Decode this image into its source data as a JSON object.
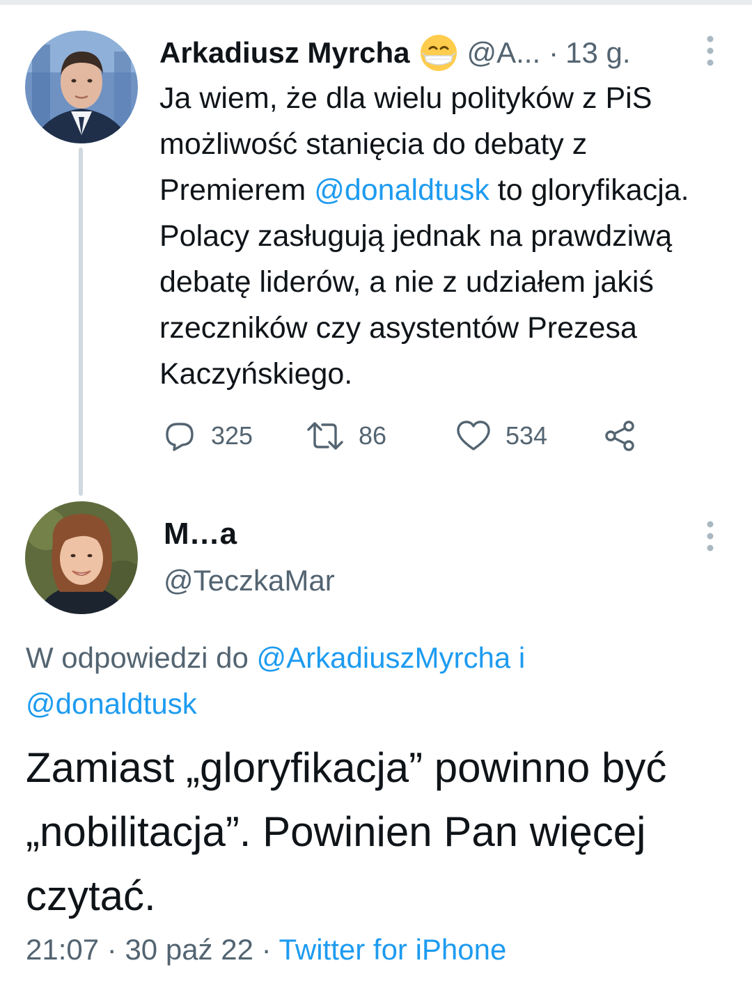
{
  "parent_tweet": {
    "author_name": "Arkadiusz Myrcha",
    "author_emoji": "😷",
    "handle": "@A...",
    "separator": "·",
    "time_ago": "13 g.",
    "text_parts": {
      "before_mention": "Ja wiem, że dla wielu polityków z PiS możliwość stanięcia do debaty z Premierem ",
      "mention": "@donaldtusk",
      "after_mention": " to gloryfikacja. Polacy zasługują jednak na prawdziwą debatę liderów, a nie z udziałem jakiś rzeczników czy asystentów Prezesa Kaczyńskiego."
    },
    "actions": {
      "reply_count": "325",
      "retweet_count": "86",
      "like_count": "534"
    }
  },
  "reply_tweet": {
    "author_name": "M…a",
    "handle": "@TeczkaMar",
    "context": {
      "prefix": "W odpowiedzi do ",
      "mention_1": "@ArkadiuszMyrcha",
      "conjunction": " i ",
      "mention_2": "@donaldtusk"
    },
    "text": "Zamiast „gloryfikacja” powinno być „nobilitacja”. Powinien Pan więcej czytać.",
    "meta": {
      "time": "21:07",
      "separator": "·",
      "date": "30 paź 22",
      "source": "Twitter for iPhone"
    }
  },
  "colors": {
    "text_primary": "#0f1419",
    "text_secondary": "#536471",
    "link": "#1d9bf0",
    "thread_line": "#cfd9de"
  },
  "icons": [
    "more-vertical-icon",
    "reply-icon",
    "retweet-icon",
    "like-icon",
    "share-icon",
    "face-mask-emoji-icon"
  ]
}
